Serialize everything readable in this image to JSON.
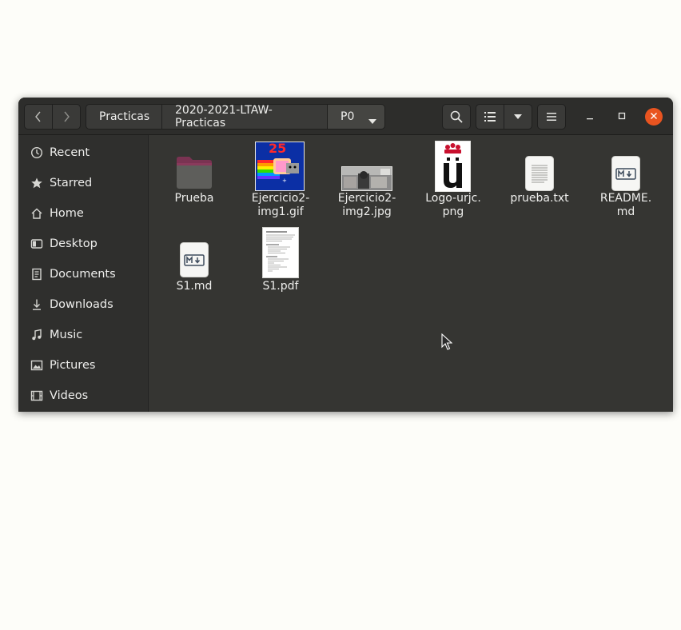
{
  "breadcrumb": [
    "Practicas",
    "2020-2021-LTAW-Practicas",
    "P0"
  ],
  "sidebar": {
    "items": [
      {
        "label": "Recent",
        "icon": "clock-icon"
      },
      {
        "label": "Starred",
        "icon": "star-icon"
      },
      {
        "label": "Home",
        "icon": "home-icon"
      },
      {
        "label": "Desktop",
        "icon": "desktop-icon"
      },
      {
        "label": "Documents",
        "icon": "document-icon"
      },
      {
        "label": "Downloads",
        "icon": "download-icon"
      },
      {
        "label": "Music",
        "icon": "music-icon"
      },
      {
        "label": "Pictures",
        "icon": "picture-icon"
      },
      {
        "label": "Videos",
        "icon": "video-icon"
      }
    ]
  },
  "files": [
    {
      "name_line1": "Prueba",
      "name_line2": "",
      "type": "folder"
    },
    {
      "name_line1": "Ejercicio2-",
      "name_line2": "img1.gif",
      "type": "gif"
    },
    {
      "name_line1": "Ejercicio2-",
      "name_line2": "img2.jpg",
      "type": "jpg"
    },
    {
      "name_line1": "Logo-urjc.",
      "name_line2": "png",
      "type": "png"
    },
    {
      "name_line1": "prueba.txt",
      "name_line2": "",
      "type": "text"
    },
    {
      "name_line1": "README.",
      "name_line2": "md",
      "type": "markdown"
    },
    {
      "name_line1": "S1.md",
      "name_line2": "",
      "type": "markdown"
    },
    {
      "name_line1": "S1.pdf",
      "name_line2": "",
      "type": "pdf"
    }
  ],
  "icons": {
    "back": "chevron-left-icon",
    "forward": "chevron-right-icon",
    "search": "search-icon",
    "list_view": "list-view-icon",
    "view_options": "chevron-down-icon",
    "menu": "hamburger-menu-icon",
    "minimize": "minimize-icon",
    "maximize": "maximize-icon",
    "close": "close-icon"
  },
  "colors": {
    "folder": "#8a3a5c",
    "close_button": "#e95420",
    "urjc_red": "#c8102e"
  },
  "gif_overlay_text": "25"
}
